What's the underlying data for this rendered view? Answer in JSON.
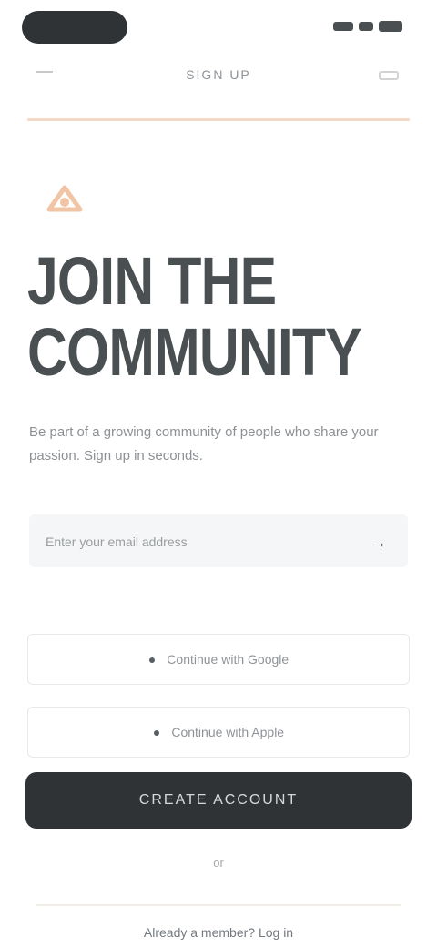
{
  "status_bar": {
    "signal": "signal-icon",
    "battery": "battery-icon"
  },
  "header": {
    "title": "SIGN UP",
    "back_icon": "back-icon",
    "right_icon": "card-icon"
  },
  "logo": {
    "icon": "logo-icon",
    "accent": "#f3c6a8"
  },
  "hero": {
    "title_line1": "JOIN THE",
    "title_line2": "COMMUNITY",
    "description": "Be part of a growing community of people who share your passion. Sign up in seconds."
  },
  "form": {
    "email_placeholder": "Enter your email address",
    "submit_icon": "arrow-right-icon"
  },
  "oauth": {
    "google_label": "Continue with Google",
    "apple_label": "Continue with Apple"
  },
  "cta": {
    "label": "Create account"
  },
  "or_text": "or",
  "footer": {
    "link": "Already a member? Log in"
  },
  "colors": {
    "dark": "#2f3336",
    "accent": "#f3c6a8",
    "muted": "#8d9196"
  }
}
